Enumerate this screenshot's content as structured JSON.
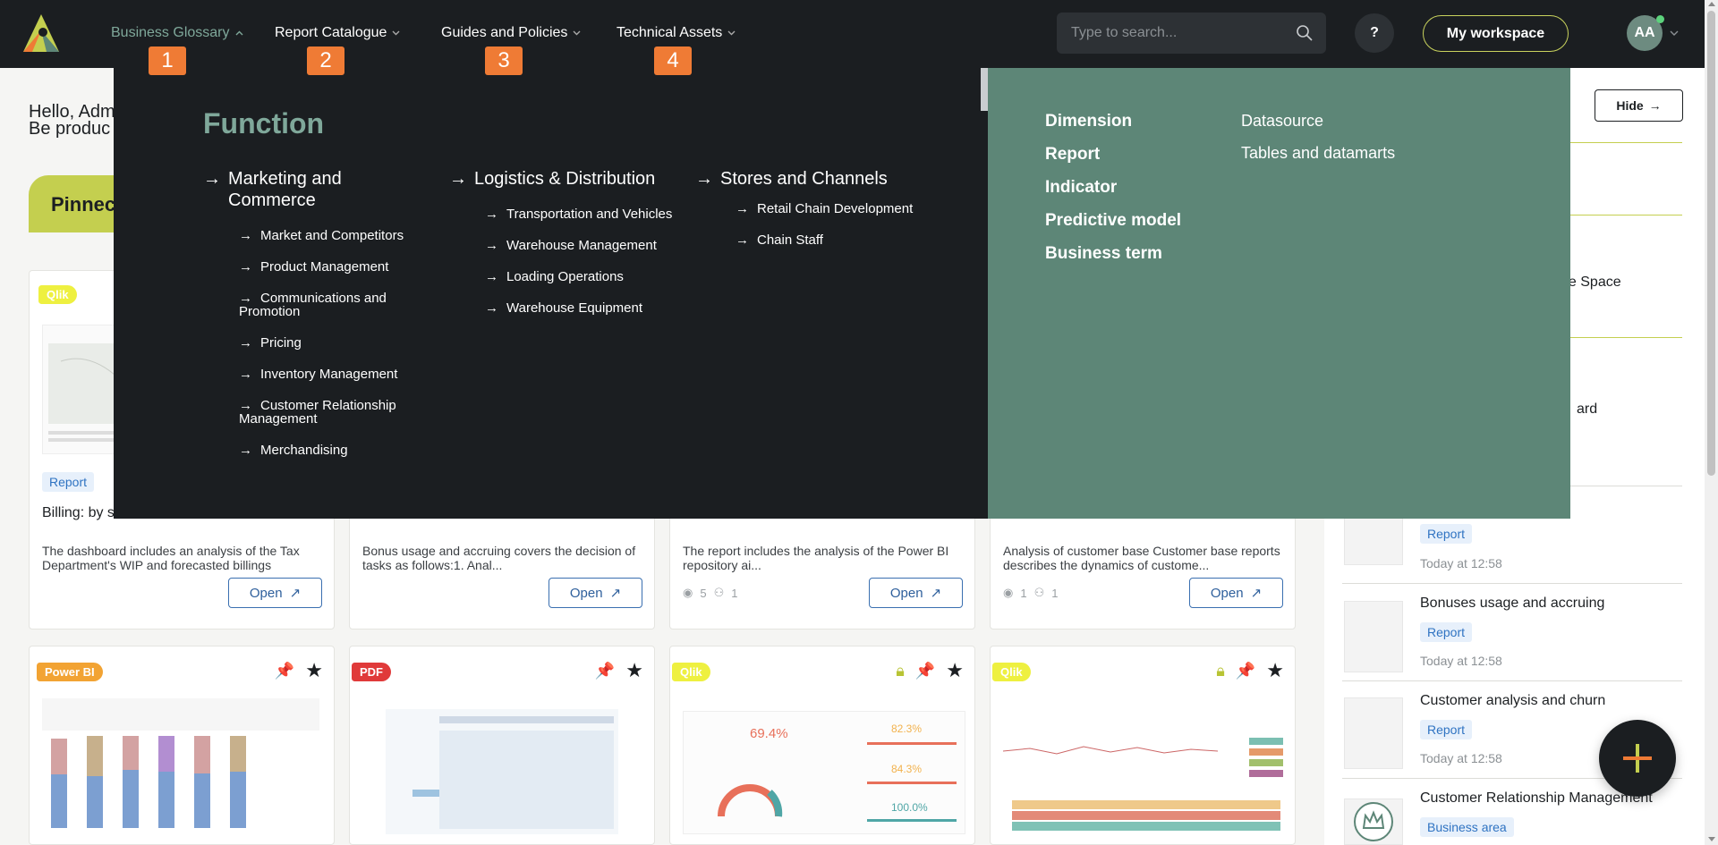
{
  "nav": {
    "items": [
      {
        "label": "Business Glossary",
        "badge": "1"
      },
      {
        "label": "Report Catalogue",
        "badge": "2"
      },
      {
        "label": "Guides and Policies",
        "badge": "3"
      },
      {
        "label": "Technical Assets",
        "badge": "4"
      }
    ],
    "search_placeholder": "Type to search...",
    "help_label": "?",
    "workspace_label": "My workspace",
    "avatar_initials": "AA"
  },
  "page": {
    "greeting_line1": "Hello, Adm",
    "greeting_line2": "Be produc",
    "pinned_label": "Pinnec"
  },
  "cards_top": [
    {
      "tag": "Qlik",
      "chip": "Report",
      "title": "Billing: by s",
      "desc": "The dashboard includes an analysis of the Tax Department's WIP and forecasted billings",
      "open": "Open"
    },
    {
      "desc": "Bonus usage and accruing covers the decision of tasks as follows:1. Anal...",
      "open": "Open"
    },
    {
      "desc": "The report includes the analysis of the Power BI repository ai...",
      "open": "Open",
      "views": "5",
      "users": "1"
    },
    {
      "desc": "Analysis of customer base  Customer base reports describes the dynamics of custome...",
      "open": "Open",
      "views": "1",
      "users": "1"
    }
  ],
  "cards_bottom": [
    {
      "tag": "Power BI"
    },
    {
      "tag": "PDF"
    },
    {
      "tag": "Qlik",
      "kpi1": "69.4%",
      "kpi2": "82.3%",
      "kpi3": "84.3%",
      "kpi4": "100.0%"
    },
    {
      "tag": "Qlik"
    }
  ],
  "right_panel": {
    "hide_label": "Hide",
    "partial_1": "he Space",
    "partial_2": "ard",
    "items": [
      {
        "title": "",
        "chip": "Report",
        "date": "Today at 12:58"
      },
      {
        "title": "Bonuses usage and accruing",
        "chip": "Report",
        "date": "Today at 12:58"
      },
      {
        "title": "Customer analysis and churn",
        "chip": "Report",
        "date": "Today at 12:58"
      },
      {
        "title": "Customer Relationship Management",
        "chip": "Business area",
        "date": ""
      }
    ]
  },
  "mega": {
    "heading": "Function",
    "columns": [
      {
        "head": "Marketing and Commerce",
        "subs": [
          "Market and Competitors",
          "Product Management",
          "Communications and Promotion",
          "Pricing",
          "Inventory Management",
          "Customer Relationship Management",
          "Merchandising"
        ]
      },
      {
        "head": "Logistics & Distribution",
        "subs": [
          "Transportation and Vehicles",
          "Warehouse Management",
          "Loading Operations",
          "Warehouse Equipment"
        ]
      },
      {
        "head": "Stores and Channels",
        "subs": [
          "Retail Chain Development",
          "Chain Staff"
        ]
      }
    ],
    "right_col1": [
      "Dimension",
      "Report",
      "Indicator",
      "Predictive model",
      "Business term"
    ],
    "right_col2": [
      "Datasource",
      "Tables and datamarts"
    ]
  },
  "colors": {
    "header_bg": "#1b1e21",
    "accent_green": "#7fa89a",
    "panel_green": "#5d8677",
    "badge_orange": "#ef7b35",
    "lime": "#c4cf4f"
  }
}
